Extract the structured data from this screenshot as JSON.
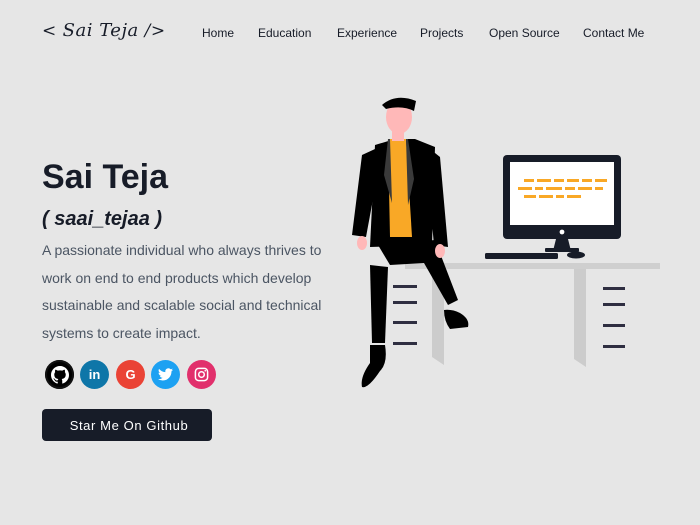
{
  "logo": {
    "open": "< ",
    "name": "Sai Teja",
    "close": " />"
  },
  "nav": {
    "items": [
      {
        "id": "home",
        "label": "Home"
      },
      {
        "id": "education",
        "label": "Education"
      },
      {
        "id": "experience",
        "label": "Experience"
      },
      {
        "id": "projects",
        "label": "Projects"
      },
      {
        "id": "open-source",
        "label": "Open Source"
      },
      {
        "id": "contact",
        "label": "Contact Me"
      }
    ]
  },
  "hero": {
    "name": "Sai Teja",
    "handle": "( saai_tejaa )",
    "bio": "A passionate individual who always thrives to work on end to end products which develop sustainable and scalable social and technical systems to create impact."
  },
  "socials": [
    {
      "id": "github",
      "icon": "github-icon",
      "glyph": "",
      "color": "#000000"
    },
    {
      "id": "linkedin",
      "icon": "linkedin-icon",
      "glyph": "in",
      "color": "#0e76a8"
    },
    {
      "id": "google",
      "icon": "google-icon",
      "glyph": "G",
      "color": "#ea4335"
    },
    {
      "id": "twitter",
      "icon": "twitter-icon",
      "glyph": "",
      "color": "#1da1f2"
    },
    {
      "id": "instagram",
      "icon": "instagram-icon",
      "glyph": "",
      "color": "#e1306c"
    }
  ],
  "cta": {
    "icon": "",
    "label": "Star Me On Github"
  },
  "colors": {
    "primary": "#171c28",
    "text_secondary": "#4b5563",
    "background": "#e6e6e6",
    "accent_shirt": "#f9a826"
  }
}
